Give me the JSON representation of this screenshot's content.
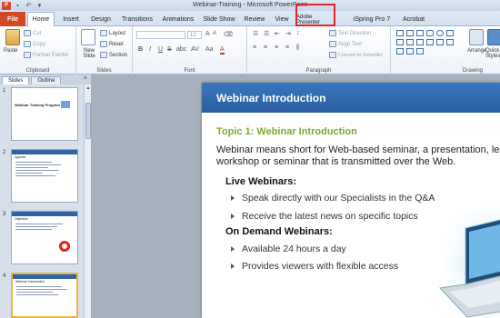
{
  "window": {
    "title": "Webinar-Training - Microsoft PowerPoint",
    "app_icon_letter": "P",
    "qat": [
      "save-icon",
      "undo-icon",
      "customize-icon"
    ]
  },
  "tabs": [
    {
      "label": "File",
      "kind": "file"
    },
    {
      "label": "Home",
      "kind": "active"
    },
    {
      "label": "Insert"
    },
    {
      "label": "Design"
    },
    {
      "label": "Transitions"
    },
    {
      "label": "Animations"
    },
    {
      "label": "Slide Show"
    },
    {
      "label": "Review"
    },
    {
      "label": "View"
    },
    {
      "label": "Adobe Presenter",
      "highlighted": true
    },
    {
      "label": "iSpring Pro 7"
    },
    {
      "label": "Acrobat"
    }
  ],
  "ribbon": {
    "clipboard": {
      "label": "Clipboard",
      "paste": "Paste",
      "cut": "Cut",
      "copy": "Copy",
      "format_painter": "Format Painter"
    },
    "slides": {
      "label": "Slides",
      "new_slide": "New Slide",
      "layout": "Layout",
      "reset": "Reset",
      "section": "Section"
    },
    "font": {
      "label": "Font",
      "size": "12",
      "bold": "B",
      "italic": "I",
      "underline": "U",
      "strike": "S",
      "shadow": "abc",
      "spacing": "AV",
      "case": "Aa",
      "color": "A"
    },
    "paragraph": {
      "label": "Paragraph",
      "text_direction": "Text Direction",
      "align_text": "Align Text",
      "convert_smartart": "Convert to SmartArt"
    },
    "drawing": {
      "label": "Drawing",
      "arrange": "Arrange",
      "quick_styles": "Quick Styles"
    }
  },
  "panel": {
    "tabs": [
      "Slides",
      "Outline"
    ],
    "close": "×",
    "slides": [
      {
        "num": "1",
        "title": "Webinar Training Program"
      },
      {
        "num": "2",
        "title": "Agenda"
      },
      {
        "num": "3",
        "title": "Objective"
      },
      {
        "num": "4",
        "title": "Webinar Introduction"
      }
    ]
  },
  "slide": {
    "title": "Webinar Introduction",
    "topic": "Topic 1: Webinar Introduction",
    "para_line1": "Webinar means short for Web-based seminar, a presentation, lecture,",
    "para_line2": "workshop or seminar that is transmitted over the Web.",
    "live_heading": "Live Webinars:",
    "live_bullets": [
      "Speak directly with our Specialists in the Q&A",
      "Receive the latest news on specific topics"
    ],
    "ondemand_heading": "On Demand Webinars:",
    "ondemand_bullets": [
      "Available 24 hours a day",
      "Provides viewers with flexible access"
    ]
  },
  "colors": {
    "file_tab": "#d24726",
    "highlight": "#e0262b",
    "slide_title_bar": "#2f6bb3",
    "topic_green": "#7da836"
  }
}
